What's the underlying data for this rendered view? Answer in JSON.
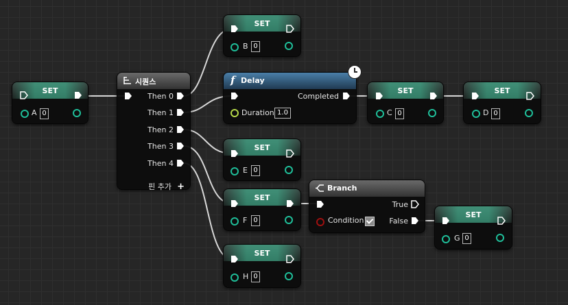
{
  "nodes": {
    "set_a": {
      "title": "SET",
      "var": "A",
      "value": "0"
    },
    "set_b": {
      "title": "SET",
      "var": "B",
      "value": "0"
    },
    "set_c": {
      "title": "SET",
      "var": "C",
      "value": "0"
    },
    "set_d": {
      "title": "SET",
      "var": "D",
      "value": "0"
    },
    "set_e": {
      "title": "SET",
      "var": "E",
      "value": "0"
    },
    "set_f": {
      "title": "SET",
      "var": "F",
      "value": "0"
    },
    "set_g": {
      "title": "SET",
      "var": "G",
      "value": "0"
    },
    "set_h": {
      "title": "SET",
      "var": "H",
      "value": "0"
    },
    "sequence": {
      "title": "시퀀스",
      "outputs": [
        "Then 0",
        "Then 1",
        "Then 2",
        "Then 3",
        "Then 4"
      ],
      "add_pin": "핀 추가"
    },
    "delay": {
      "title": "Delay",
      "func_glyph": "f",
      "completed": "Completed",
      "duration_label": "Duration",
      "duration_value": "1.0"
    },
    "branch": {
      "title": "Branch",
      "true_label": "True",
      "false_label": "False",
      "condition_label": "Condition",
      "condition_checked": true
    }
  },
  "colors": {
    "background": "#262626",
    "float_pin": "#1fbf9a",
    "wire": "#dcdcdc",
    "bool_pin": "#a01010",
    "delay_header": "#4a7fa8"
  }
}
